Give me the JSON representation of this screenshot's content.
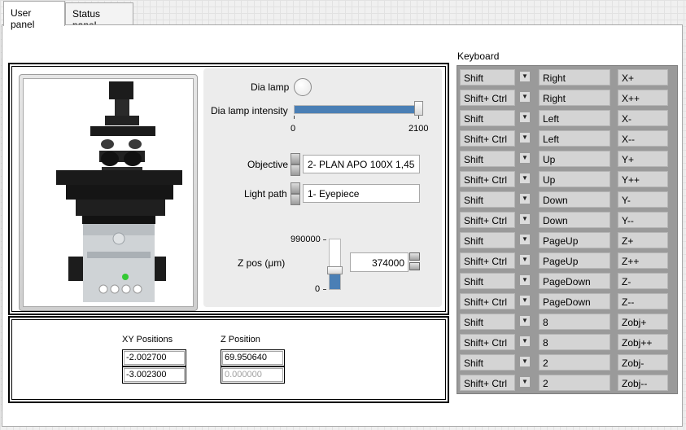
{
  "tabs": [
    {
      "label": "User panel",
      "active": true
    },
    {
      "label": "Status panel",
      "active": false
    }
  ],
  "controls": {
    "dia_lamp_label": "Dia lamp",
    "dia_lamp_on": false,
    "intensity_label": "Dia lamp intensity",
    "intensity_min": "0",
    "intensity_max": "2100",
    "intensity_value": 2100,
    "objective_label": "Objective",
    "objective_value": "2- PLAN APO 100X 1,45",
    "lightpath_label": "Light path",
    "lightpath_value": "1- Eyepiece",
    "z_label": "Z pos (μm)",
    "z_max": "990000",
    "z_min": "0",
    "z_value": "374000",
    "z_fraction": 0.378
  },
  "positions": {
    "xy_label": "XY Positions",
    "z_label": "Z Position",
    "x": "-2.002700",
    "y": "-3.002300",
    "z": "69.950640",
    "z2": "0.000000"
  },
  "keyboard": {
    "title": "Keyboard",
    "rows": [
      {
        "mod": "Shift",
        "key": "Right",
        "action": "X+"
      },
      {
        "mod": "Shift+ Ctrl",
        "key": "Right",
        "action": "X++"
      },
      {
        "mod": "Shift",
        "key": "Left",
        "action": "X-"
      },
      {
        "mod": "Shift+ Ctrl",
        "key": "Left",
        "action": "X--"
      },
      {
        "mod": "Shift",
        "key": "Up",
        "action": "Y+"
      },
      {
        "mod": "Shift+ Ctrl",
        "key": "Up",
        "action": "Y++"
      },
      {
        "mod": "Shift",
        "key": "Down",
        "action": "Y-"
      },
      {
        "mod": "Shift+ Ctrl",
        "key": "Down",
        "action": "Y--"
      },
      {
        "mod": "Shift",
        "key": "PageUp",
        "action": "Z+"
      },
      {
        "mod": "Shift+ Ctrl",
        "key": "PageUp",
        "action": "Z++"
      },
      {
        "mod": "Shift",
        "key": "PageDown",
        "action": "Z-"
      },
      {
        "mod": "Shift+ Ctrl",
        "key": "PageDown",
        "action": "Z--"
      },
      {
        "mod": "Shift",
        "key": "8",
        "action": "Zobj+"
      },
      {
        "mod": "Shift+ Ctrl",
        "key": "8",
        "action": "Zobj++"
      },
      {
        "mod": "Shift",
        "key": "2",
        "action": "Zobj-"
      },
      {
        "mod": "Shift+ Ctrl",
        "key": "2",
        "action": "Zobj--"
      }
    ]
  }
}
